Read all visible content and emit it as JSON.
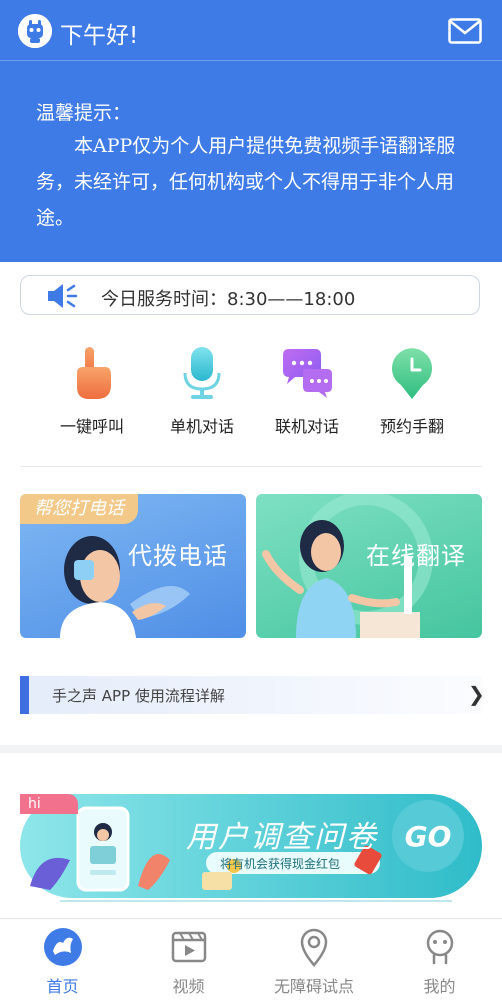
{
  "header": {
    "greeting": "下午好!",
    "notice_title": "温馨提示：",
    "notice_body": "本APP仅为个人用户提供免费视频手语翻译服务，未经许可，任何机构或个人不得用于非个人用途。"
  },
  "service": {
    "hours_text": "今日服务时间：8:30——18:00"
  },
  "quick_actions": [
    {
      "label": "一键呼叫",
      "icon": "hand-pointer-icon"
    },
    {
      "label": "单机对话",
      "icon": "microphone-icon"
    },
    {
      "label": "联机对话",
      "icon": "chat-bubbles-icon"
    },
    {
      "label": "预约手翻",
      "icon": "clock-icon"
    }
  ],
  "cards": {
    "call": {
      "badge": "帮您打电话",
      "title": "代拨电话"
    },
    "translate": {
      "title": "在线翻译"
    }
  },
  "flow": {
    "label": "手之声 APP 使用流程详解"
  },
  "survey": {
    "tag": "hi",
    "title": "用户调查问卷",
    "subtitle": "将有机会获得现金红包",
    "go": "GO"
  },
  "tabs": [
    {
      "label": "首页",
      "icon": "home-icon",
      "active": true
    },
    {
      "label": "视频",
      "icon": "video-icon",
      "active": false
    },
    {
      "label": "无障碍试点",
      "icon": "location-pin-icon",
      "active": false
    },
    {
      "label": "我的",
      "icon": "profile-icon",
      "active": false
    }
  ],
  "colors": {
    "primary": "#3f7be6",
    "badge": "#f3c98a",
    "survey": "#3ec7d1"
  }
}
